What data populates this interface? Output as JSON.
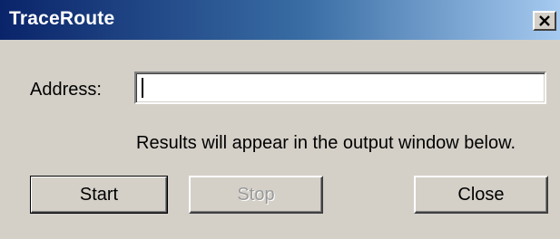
{
  "window": {
    "title": "TraceRoute",
    "close_icon": "close-x-icon"
  },
  "form": {
    "address_label": "Address:",
    "address_value": "",
    "info_text": "Results will appear in the output window below."
  },
  "buttons": {
    "start": "Start",
    "stop": "Stop",
    "close": "Close"
  }
}
